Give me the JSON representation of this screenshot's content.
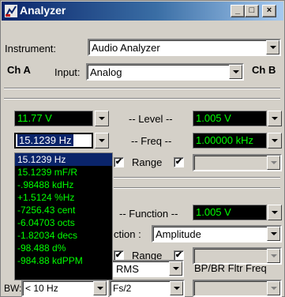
{
  "window": {
    "title": "Analyzer"
  },
  "titlebar": {
    "min": "_",
    "max": "□",
    "close": "×"
  },
  "instrument": {
    "label": "Instrument:",
    "value": "Audio Analyzer"
  },
  "channel": {
    "ch_a": "Ch A",
    "input_label": "Input:",
    "input_value": "Analog",
    "ch_b": "Ch B"
  },
  "level": {
    "label": "-- Level --",
    "a_value": "11.77  V",
    "b_value": "1.005  V"
  },
  "freq": {
    "label": "-- Freq --",
    "a_value": "15.1239 Hz",
    "b_value": "1.00000 kHz"
  },
  "range1": {
    "label": "Range"
  },
  "function": {
    "label": "-- Function --",
    "b_value": "1.005  V",
    "mode_label": "ction :",
    "mode_value": "Amplitude"
  },
  "range2": {
    "label": "Range"
  },
  "bottom": {
    "detector_value": "RMS",
    "bp_label": "BP/BR Fltr Freq",
    "bw_label": "BW:",
    "bw_value": "< 10 Hz",
    "fs_value": "Fs/2"
  },
  "unit_dropdown": {
    "items": [
      "15.1239  Hz",
      "15.1239 mF/R",
      "-.98488 kdHz",
      "+1.5124  %Hz",
      "-7256.43 cent",
      "-6.04703 octs",
      "-1.82034 decs",
      "-98.488  d%",
      "-984.88 kdPPM"
    ],
    "selected_index": 0
  },
  "colors": {
    "readout_bg": "#000000",
    "readout_fg": "#00ff00",
    "title_bg": "#0a246a",
    "face": "#d4d0c8"
  }
}
